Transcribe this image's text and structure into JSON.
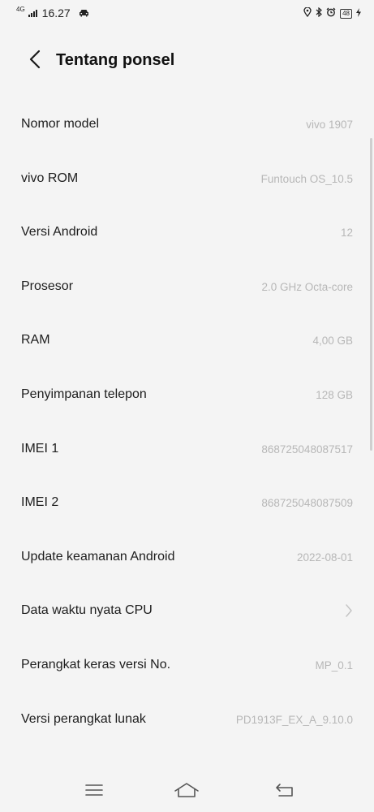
{
  "status_bar": {
    "network": "4G",
    "time": "16.27",
    "battery": "48"
  },
  "header": {
    "title": "Tentang ponsel"
  },
  "items": [
    {
      "label": "Nomor model",
      "value": "vivo 1907"
    },
    {
      "label": "vivo ROM",
      "value": "Funtouch OS_10.5"
    },
    {
      "label": "Versi Android",
      "value": "12"
    },
    {
      "label": "Prosesor",
      "value": "2.0 GHz Octa-core"
    },
    {
      "label": "RAM",
      "value": "4,00 GB"
    },
    {
      "label": "Penyimpanan telepon",
      "value": "128 GB"
    },
    {
      "label": "IMEI 1",
      "value": "868725048087517"
    },
    {
      "label": "IMEI 2",
      "value": "868725048087509"
    },
    {
      "label": "Update keamanan Android",
      "value": "2022-08-01"
    },
    {
      "label": "Data waktu nyata CPU",
      "value": ""
    },
    {
      "label": "Perangkat keras versi No.",
      "value": "MP_0.1"
    },
    {
      "label": "Versi perangkat lunak",
      "value": "PD1913F_EX_A_9.10.0"
    }
  ],
  "icons": {
    "back": "chevron-left-icon",
    "row_arrow": "chevron-right-icon",
    "nav_menu": "menu-icon",
    "nav_home": "home-icon",
    "nav_back": "return-icon"
  },
  "colors": {
    "background": "#f4f4f4",
    "label": "#1d1d1d",
    "value": "#b7b7b7"
  }
}
